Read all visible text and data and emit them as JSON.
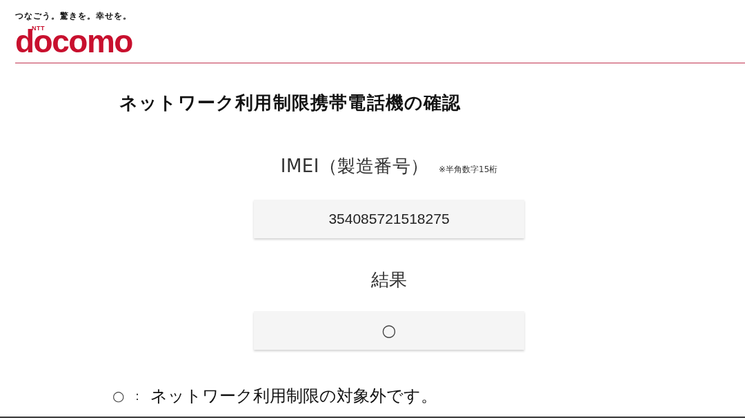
{
  "header": {
    "tagline": "つなごう。驚きを。幸せを。",
    "logo": {
      "prefix": "NTT",
      "wordmark": "docomo"
    }
  },
  "title": "ネットワーク利用制限携帯電話機の確認",
  "imei": {
    "label": "IMEI（製造番号）",
    "note": "※半角数字15桁",
    "value": "354085721518275"
  },
  "result": {
    "label": "結果",
    "value": "○"
  },
  "legend": [
    {
      "symbol": "○",
      "separator": "：",
      "description": "ネットワーク利用制限の対象外です。"
    }
  ]
}
